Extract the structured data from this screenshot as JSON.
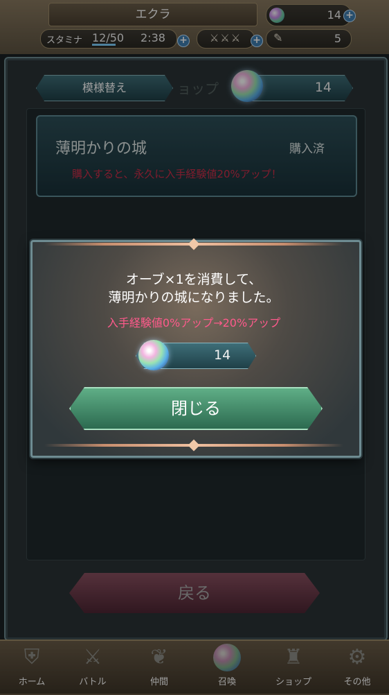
{
  "header": {
    "player_name": "エクラ",
    "orbs": "14",
    "stamina_label": "スタミナ",
    "stamina_value": "12/50",
    "stamina_timer": "2:38",
    "swords_icon": "sword-icon",
    "feathers": "5",
    "plus": "+"
  },
  "panel": {
    "style_button": "模様替え",
    "shop_ghost_text": "ョップ",
    "orb_count": "14",
    "item_name": "薄明かりの城",
    "item_status": "購入済",
    "item_desc": "購入すると、永久に入手経験値20%アップ！"
  },
  "modal": {
    "line1": "オーブ×1を消費して、",
    "line2": "薄明かりの城になりました。",
    "bonus": "入手経験値0%アップ→20%アップ",
    "orb_count": "14",
    "close_label": "閉じる"
  },
  "back_label": "戻る",
  "nav": [
    {
      "label": "ホーム",
      "icon": "home-icon"
    },
    {
      "label": "バトル",
      "icon": "battle-icon"
    },
    {
      "label": "仲間",
      "icon": "allies-icon"
    },
    {
      "label": "召喚",
      "icon": "summon-orb-icon"
    },
    {
      "label": "ショップ",
      "icon": "shop-castle-icon"
    },
    {
      "label": "その他",
      "icon": "gear-icon"
    }
  ],
  "colors": {
    "accent_teal": "#3e6e78",
    "close_green": "#5fae86",
    "back_red": "#8a5060",
    "desc_red": "#cf2e4a",
    "bonus_pink": "#ff5a8c"
  }
}
